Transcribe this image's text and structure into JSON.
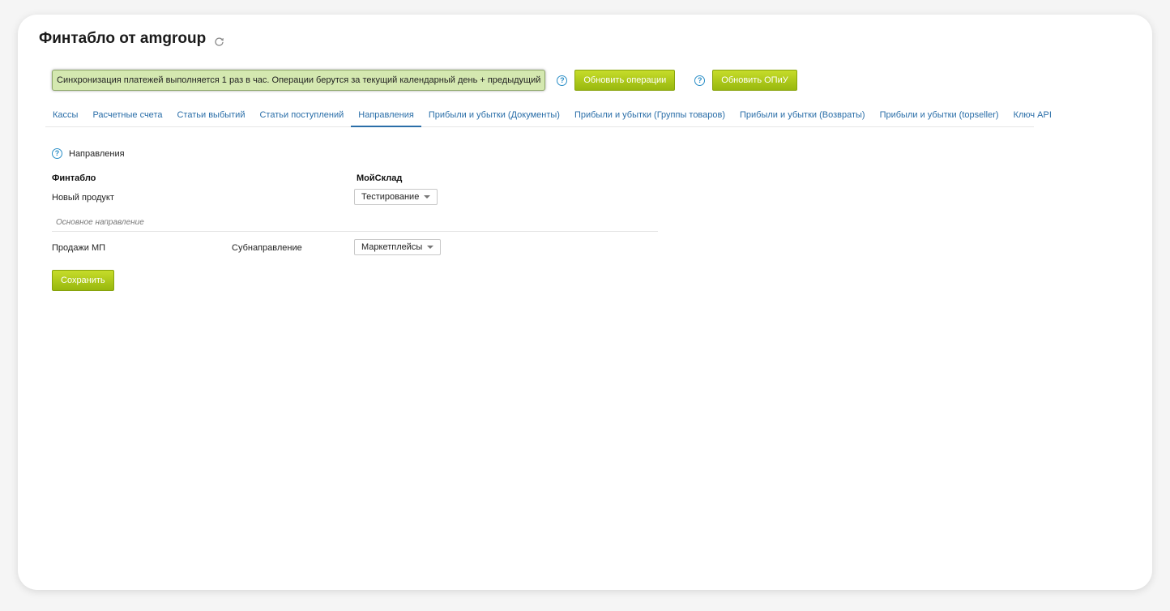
{
  "page": {
    "title": "Финтабло от amgroup"
  },
  "sync": {
    "note": "Синхронизация платежей выполняется 1 раз в час. Операции берутся за текущий календарный день + предыдущий",
    "update_operations_label": "Обновить операции",
    "update_pnl_label": "Обновить ОПиУ"
  },
  "tabs": [
    {
      "label": "Кассы",
      "active": false
    },
    {
      "label": "Расчетные счета",
      "active": false
    },
    {
      "label": "Статьи выбытий",
      "active": false
    },
    {
      "label": "Статьи поступлений",
      "active": false
    },
    {
      "label": "Направления",
      "active": true
    },
    {
      "label": "Прибыли и убытки (Документы)",
      "active": false
    },
    {
      "label": "Прибыли и убытки (Группы товаров)",
      "active": false
    },
    {
      "label": "Прибыли и убытки (Возвраты)",
      "active": false
    },
    {
      "label": "Прибыли и убытки (topseller)",
      "active": false
    },
    {
      "label": "Ключ API",
      "active": false
    }
  ],
  "section": {
    "title": "Направления",
    "col_fintablo": "Финтабло",
    "col_moysklad": "МойСклад",
    "row1": {
      "name": "Новый продукт",
      "select_value": "Тестирование"
    },
    "group_label": "Основное направление",
    "row2": {
      "name": "Продажи МП",
      "sub_label": "Субнаправление",
      "select_value": "Маркетплейсы"
    },
    "save_label": "Сохранить"
  },
  "colors": {
    "accent_green": "#a4c214",
    "link_blue": "#2a6ea8",
    "note_bg": "#d4e8b0"
  },
  "icons": {
    "refresh": "refresh-icon",
    "help": "help-icon",
    "caret": "caret-down-icon"
  }
}
